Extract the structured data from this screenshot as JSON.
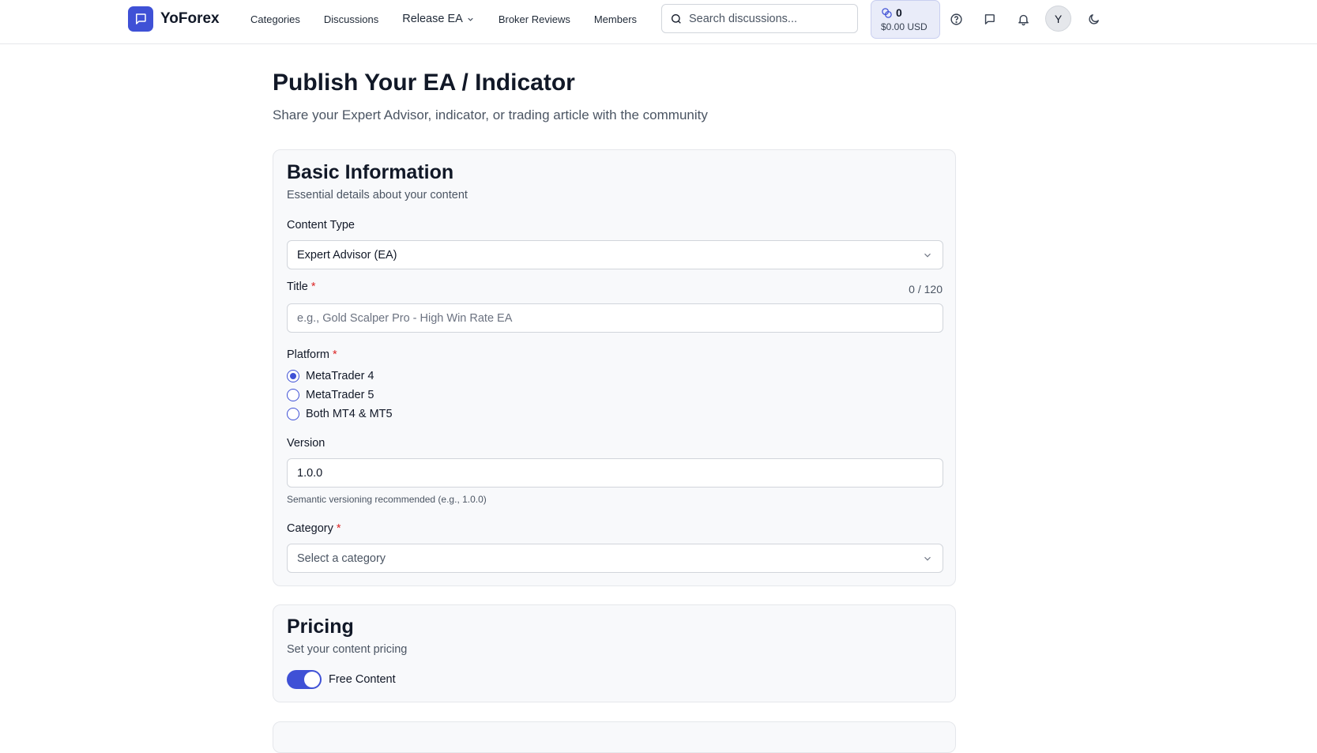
{
  "header": {
    "brand": "YoForex",
    "nav": [
      {
        "label": "Categories"
      },
      {
        "label": "Discussions"
      },
      {
        "label": "Release EA"
      },
      {
        "label": "Broker Reviews"
      },
      {
        "label": "Members"
      }
    ],
    "search_placeholder": "Search discussions...",
    "wallet": {
      "coins": "0",
      "usd": "$0.00 USD"
    },
    "avatar_initial": "Y",
    "accent": "#3f51d6"
  },
  "page": {
    "title": "Publish Your EA / Indicator",
    "subtitle": "Share your Expert Advisor, indicator, or trading article with the community"
  },
  "basic": {
    "title": "Basic Information",
    "subtitle": "Essential details about your content",
    "content_type_label": "Content Type",
    "content_type_value": "Expert Advisor (EA)",
    "title_label": "Title",
    "required_mark": "*",
    "title_counter": "0 / 120",
    "title_placeholder": "e.g., Gold Scalper Pro - High Win Rate EA",
    "platform_label": "Platform",
    "platforms": [
      {
        "label": "MetaTrader 4",
        "selected": true
      },
      {
        "label": "MetaTrader 5",
        "selected": false
      },
      {
        "label": "Both MT4 & MT5",
        "selected": false
      }
    ],
    "version_label": "Version",
    "version_value": "1.0.0",
    "version_hint": "Semantic versioning recommended (e.g., 1.0.0)",
    "category_label": "Category",
    "category_placeholder": "Select a category"
  },
  "pricing": {
    "title": "Pricing",
    "subtitle": "Set your content pricing",
    "free_label": "Free Content",
    "free_enabled": true
  }
}
